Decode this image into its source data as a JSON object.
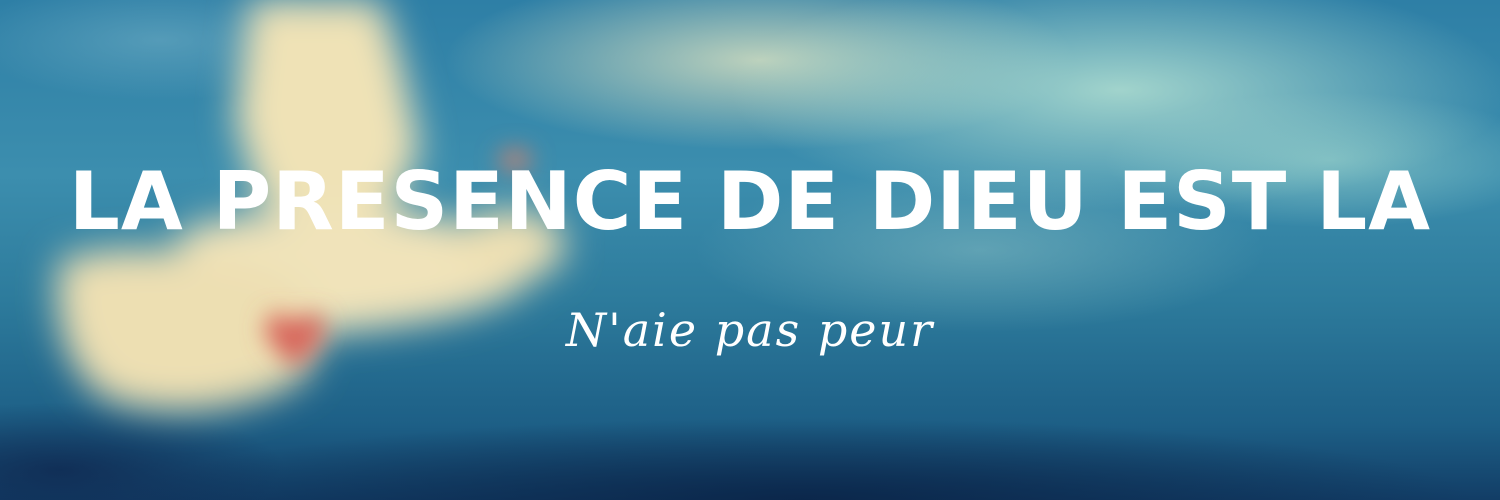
{
  "banner": {
    "title": "LA PRESENCE DE DIEU EST LA",
    "subtitle": "N'aie pas peur"
  },
  "colors": {
    "text": "#ffffff",
    "sky_blue": "#2e7fa6",
    "dove_cream": "#f2e4b8",
    "heart_red": "#d8665c"
  },
  "icons": {
    "dove": "dove-icon",
    "heart": "heart-icon"
  }
}
